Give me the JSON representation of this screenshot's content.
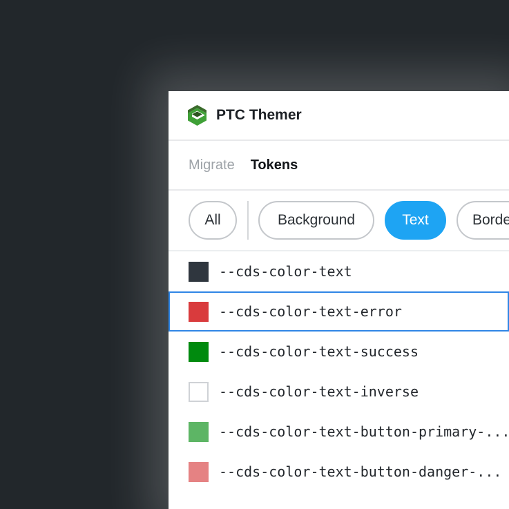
{
  "app": {
    "title": "PTC Themer",
    "logo_icon": "ptc-logo-icon"
  },
  "tabs": [
    {
      "label": "Migrate",
      "active": false
    },
    {
      "label": "Tokens",
      "active": true
    }
  ],
  "filters": {
    "all_label": "All",
    "chips": [
      {
        "label": "Background",
        "selected": false
      },
      {
        "label": "Text",
        "selected": true
      },
      {
        "label": "Borde",
        "selected": false
      }
    ]
  },
  "tokens": [
    {
      "name": "--cds-color-text",
      "color": "#2f363e"
    },
    {
      "name": "--cds-color-text-error",
      "color": "#d93b3d",
      "focused": true
    },
    {
      "name": "--cds-color-text-success",
      "color": "#008a0e"
    },
    {
      "name": "--cds-color-text-inverse",
      "color": "#ffffff"
    },
    {
      "name": "--cds-color-text-button-primary-...",
      "color": "#5db565"
    },
    {
      "name": "--cds-color-text-button-danger-...",
      "color": "#e58283"
    }
  ],
  "colors": {
    "accent": "#1ea4f3",
    "focus": "#2f86e6",
    "background": "#22272b"
  }
}
